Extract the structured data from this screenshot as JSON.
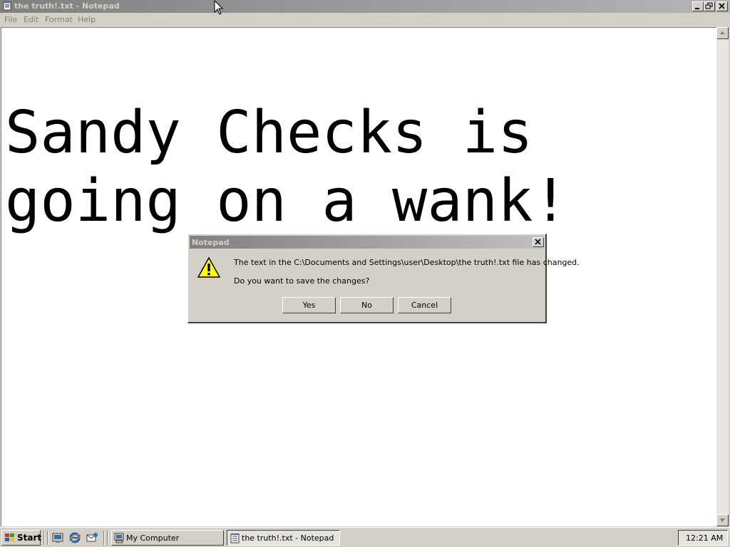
{
  "window": {
    "title": "the truth!.txt - Notepad",
    "menus": [
      "File",
      "Edit",
      "Format",
      "Help"
    ],
    "content_lines": [
      "Sandy Checks is",
      "going on a wank!"
    ]
  },
  "dialog": {
    "title": "Notepad",
    "message": "The text in the C:\\Documents and Settings\\user\\Desktop\\the truth!.txt file has changed.",
    "question": "Do you want to save the changes?",
    "buttons": {
      "yes": "Yes",
      "no": "No",
      "cancel": "Cancel"
    },
    "icon": "warning-icon"
  },
  "taskbar": {
    "start_label": "Start",
    "tasks": [
      {
        "label": "My Computer",
        "icon": "computer-icon"
      },
      {
        "label": "the truth!.txt - Notepad",
        "icon": "notepad-icon"
      }
    ],
    "clock": "12:21 AM"
  },
  "colors": {
    "inactive_title_start": "#808080",
    "inactive_title_end": "#b5b5b5",
    "face": "#d4d0c8",
    "warning_yellow": "#ffff00"
  }
}
